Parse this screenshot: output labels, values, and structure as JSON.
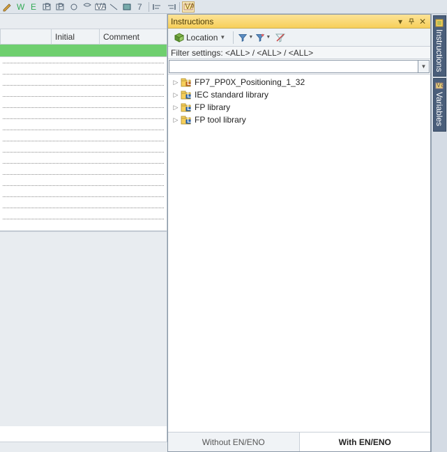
{
  "toolbar_icons": [
    "pencil-icon",
    "w-icon",
    "e-icon",
    "p-icon",
    "p2-icon",
    "d-icon",
    "s-icon",
    "var-icon",
    "l-icon",
    "b-icon",
    "seven-icon",
    "sep",
    "align-left-icon",
    "align-right-icon",
    "sep",
    "var-box-icon"
  ],
  "grid": {
    "columns": {
      "initial": "Initial",
      "comment": "Comment"
    },
    "row_count": 15
  },
  "panel": {
    "title": "Instructions",
    "location_label": "Location",
    "filter_settings": "Filter settings: <ALL> / <ALL> / <ALL>",
    "search_value": "",
    "tabs": {
      "without": "Without EN/ENO",
      "with": "With EN/ENO",
      "active": "with"
    }
  },
  "tree": [
    {
      "label": "FP7_PP0X_Positioning_1_32",
      "kind": "lib-accent"
    },
    {
      "label": "IEC standard library",
      "kind": "lib"
    },
    {
      "label": "FP library",
      "kind": "lib"
    },
    {
      "label": "FP tool library",
      "kind": "lib"
    }
  ],
  "side_tabs": [
    {
      "label": "Instructions",
      "icon": "instructions"
    },
    {
      "label": "Variables",
      "icon": "variables"
    }
  ]
}
